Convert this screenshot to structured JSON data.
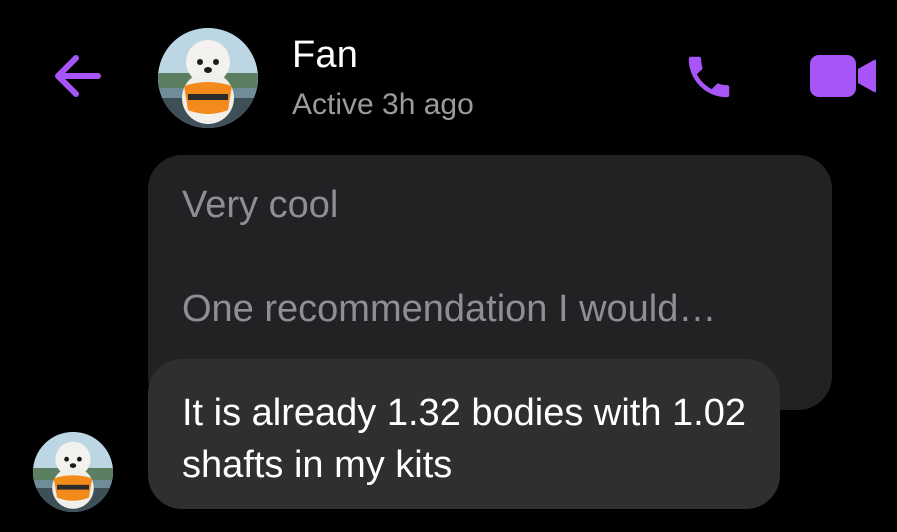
{
  "header": {
    "back_icon": "arrow-left-icon",
    "contact_name": "Fan",
    "status": "Active 3h ago",
    "call_icon": "phone-icon",
    "video_icon": "video-camera-icon",
    "accent_color": "#a855f7"
  },
  "conversation": {
    "replied_message": {
      "line1": "Very cool",
      "line2": "One recommendation I would…"
    },
    "message": {
      "text": "It is already 1.32 bodies with 1.02 shafts in my kits"
    }
  }
}
